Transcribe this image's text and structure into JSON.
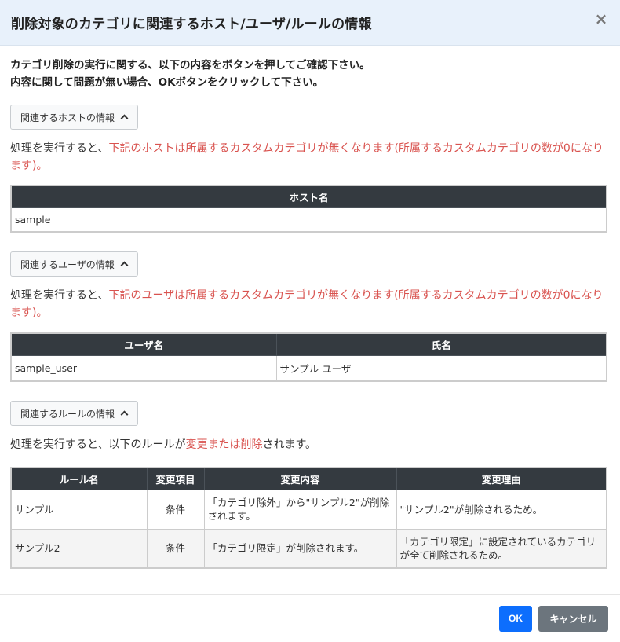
{
  "modal": {
    "title": "削除対象のカテゴリに関連するホスト/ユーザ/ルールの情報",
    "close_icon": "×"
  },
  "intro": {
    "line1": "カテゴリ削除の実行に関する、以下の内容をボタンを押してご確認下さい。",
    "line2": "内容に関して問題が無い場合、OKボタンをクリックして下さい。"
  },
  "hosts": {
    "toggle_label": "関連するホストの情報",
    "desc_prefix": "処理を実行すると、",
    "desc_red": "下記のホストは所属するカスタムカテゴリが無くなります(所属するカスタムカテゴリの数が0になります)。",
    "header": "ホスト名",
    "rows": [
      "sample"
    ]
  },
  "users": {
    "toggle_label": "関連するユーザの情報",
    "desc_prefix": "処理を実行すると、",
    "desc_red": "下記のユーザは所属するカスタムカテゴリが無くなります(所属するカスタムカテゴリの数が0になります)。",
    "headers": [
      "ユーザ名",
      "氏名"
    ],
    "rows": [
      [
        "sample_user",
        "サンプル ユーザ"
      ]
    ]
  },
  "rules": {
    "toggle_label": "関連するルールの情報",
    "desc_prefix": "処理を実行すると、以下のルールが",
    "desc_red": "変更または削除",
    "desc_suffix": "されます。",
    "headers": [
      "ルール名",
      "変更項目",
      "変更内容",
      "変更理由"
    ],
    "rows": [
      [
        "サンプル",
        "条件",
        "「カテゴリ除外」から\"サンプル2\"が削除されます。",
        "\"サンプル2\"が削除されるため。"
      ],
      [
        "サンプル2",
        "条件",
        "「カテゴリ限定」が削除されます。",
        "「カテゴリ限定」に設定されているカテゴリが全て削除されるため。"
      ]
    ]
  },
  "footer": {
    "ok_label": "OK",
    "cancel_label": "キャンセル"
  },
  "colors": {
    "header_bg": "#e8f1fb",
    "table_header": "#343a40",
    "warning_red": "#d9534f",
    "primary": "#0d6efd",
    "secondary": "#6c757d"
  }
}
